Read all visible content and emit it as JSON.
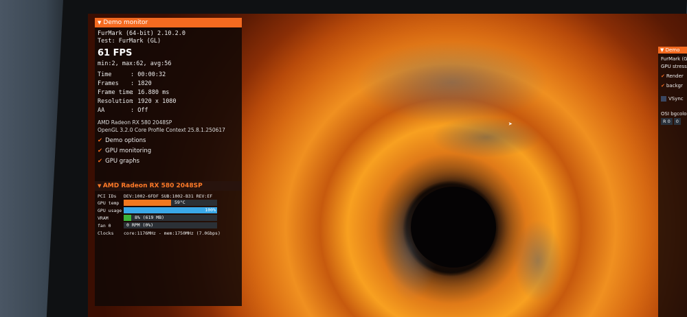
{
  "osd": {
    "panel_title": "Demo monitor",
    "app": "FurMark (64-bit) 2.10.2.0",
    "test": "Test: FurMark (GL)",
    "fps": "61 FPS",
    "minmax": "min:2, max:62, avg:56",
    "stats": [
      {
        "label": "Time",
        "value": "00:00:32"
      },
      {
        "label": "Frames",
        "value": "1820"
      },
      {
        "label": "Frame time",
        "value": "16.880 ms"
      },
      {
        "label": "Resolution",
        "value": "1920 x 1080"
      },
      {
        "label": "AA",
        "value": "Off"
      }
    ],
    "gpu_name": "AMD Radeon RX 580 2048SP",
    "opengl": "OpenGL 3.2.0 Core Profile Context 25.8.1.250617",
    "options": [
      {
        "label": "Demo options",
        "checked": true
      },
      {
        "label": "GPU monitoring",
        "checked": true
      },
      {
        "label": "GPU graphs",
        "checked": true
      }
    ]
  },
  "gpu_panel": {
    "title": "AMD Radeon RX 580 2048SP",
    "pci_label": "PCI IDs",
    "pci_value": "DEV:1002-6FDF SUB:1002-B31 REV:EF",
    "temp_label": "GPU temp",
    "temp_value": "59°C",
    "temp_fraction": 0.51,
    "usage_label": "GPU usage",
    "usage_value": "100%",
    "usage_fraction": 1.0,
    "vram_label": "VRAM",
    "vram_value": "8% (619 MB)",
    "vram_fraction": 0.08,
    "fan_label": "fan 0",
    "fan_value": "0 RPM (0%)",
    "clocks_label": "Clocks",
    "clocks_value": "core:1176MHz - mem:1750MHz (7.0Gbps)"
  },
  "right_panel": {
    "title": "Demo",
    "app": "FurMark (G",
    "gpu_stress": "GPU stress",
    "items": [
      "Render",
      "backgr"
    ],
    "vsync": "VSync",
    "bg_label": "OSI bgcolor",
    "r_label": "R",
    "r_value": "0",
    "g_value": "0"
  },
  "colors": {
    "accent": "#f46a20",
    "temp_bar": "#f07820",
    "usage_bar": "#3aa8e8",
    "vram_bar": "#3cb43c"
  }
}
